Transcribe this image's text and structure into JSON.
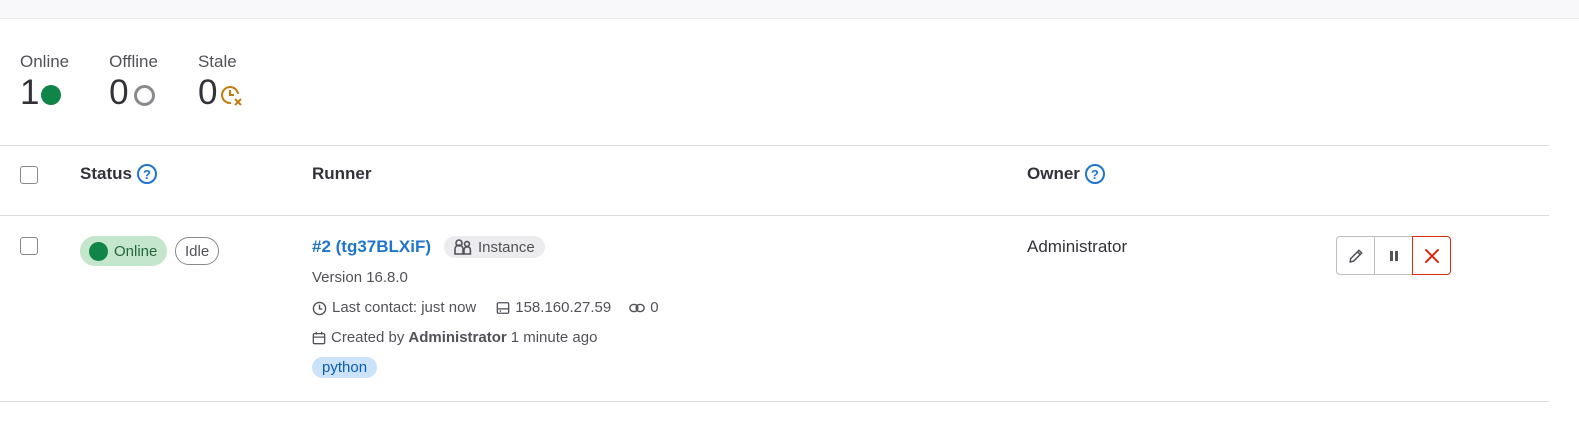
{
  "stats": [
    {
      "label": "Online",
      "value": "1",
      "icon": "online-dot-icon"
    },
    {
      "label": "Offline",
      "value": "0",
      "icon": "offline-circle-icon"
    },
    {
      "label": "Stale",
      "value": "0",
      "icon": "stale-clock-icon"
    }
  ],
  "table": {
    "headers": {
      "status": "Status",
      "runner": "Runner",
      "owner": "Owner"
    },
    "rows": [
      {
        "status": "Online",
        "job_status": "Idle",
        "runner_name": "#2 (tg37BLXiF)",
        "type": "Instance",
        "version": "Version 16.8.0",
        "last_contact": "Last contact: just now",
        "ip": "158.160.27.59",
        "jobs_count": "0",
        "created_prefix": "Created by",
        "created_by": "Administrator",
        "created_ago": "1 minute ago",
        "tag": "python",
        "owner": "Administrator"
      }
    ]
  },
  "colors": {
    "online": "#108548",
    "link": "#1f75cb",
    "stale": "#c17d10",
    "danger": "#dd2b0e"
  }
}
